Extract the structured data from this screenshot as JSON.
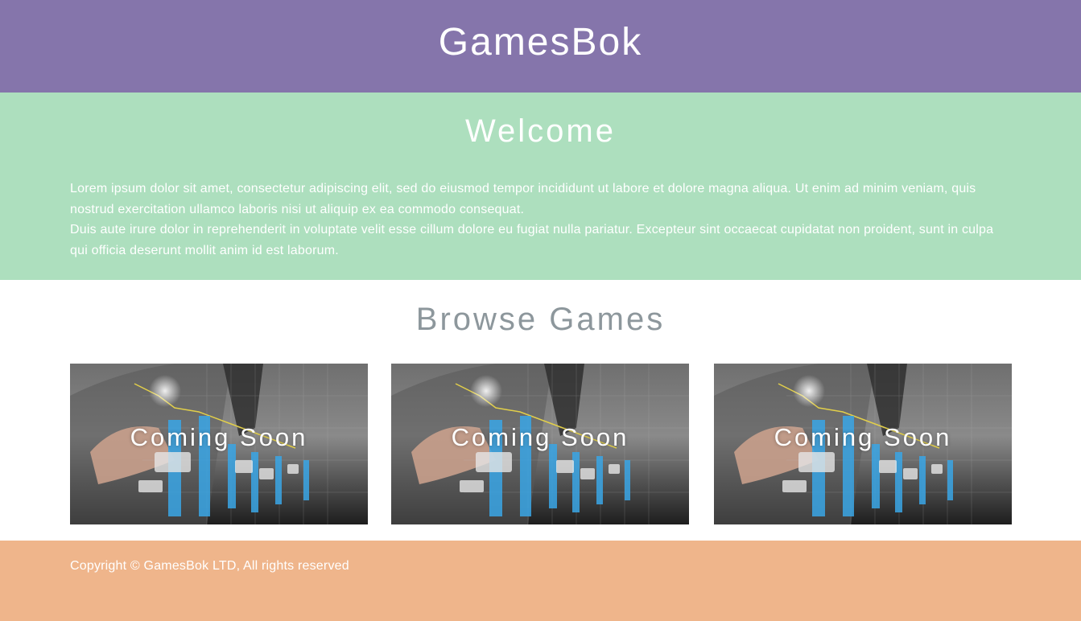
{
  "header": {
    "site_title": "GamesBok"
  },
  "welcome": {
    "title": "Welcome",
    "paragraph_1": "Lorem ipsum dolor sit amet, consectetur adipiscing elit, sed do eiusmod tempor incididunt ut labore et dolore magna aliqua. Ut enim ad minim veniam, quis nostrud exercitation ullamco laboris nisi ut aliquip ex ea commodo consequat.",
    "paragraph_2": "Duis aute irure dolor in reprehenderit in voluptate velit esse cillum dolore eu fugiat nulla pariatur. Excepteur sint occaecat cupidatat non proident, sunt in culpa qui officia deserunt mollit anim id est laborum."
  },
  "browse": {
    "title": "Browse Games",
    "cards": [
      {
        "label": "Coming Soon",
        "image_icon": "business-chart-touch-image"
      },
      {
        "label": "Coming Soon",
        "image_icon": "business-chart-touch-image"
      },
      {
        "label": "Coming Soon",
        "image_icon": "business-chart-touch-image"
      }
    ]
  },
  "footer": {
    "copyright": "Copyright © GamesBok LTD, All rights reserved"
  },
  "colors": {
    "header_bg": "#8575ab",
    "welcome_bg": "#addfbe",
    "footer_bg": "#efb58b",
    "browse_title": "#8d979c",
    "text_light": "#ffffff"
  }
}
